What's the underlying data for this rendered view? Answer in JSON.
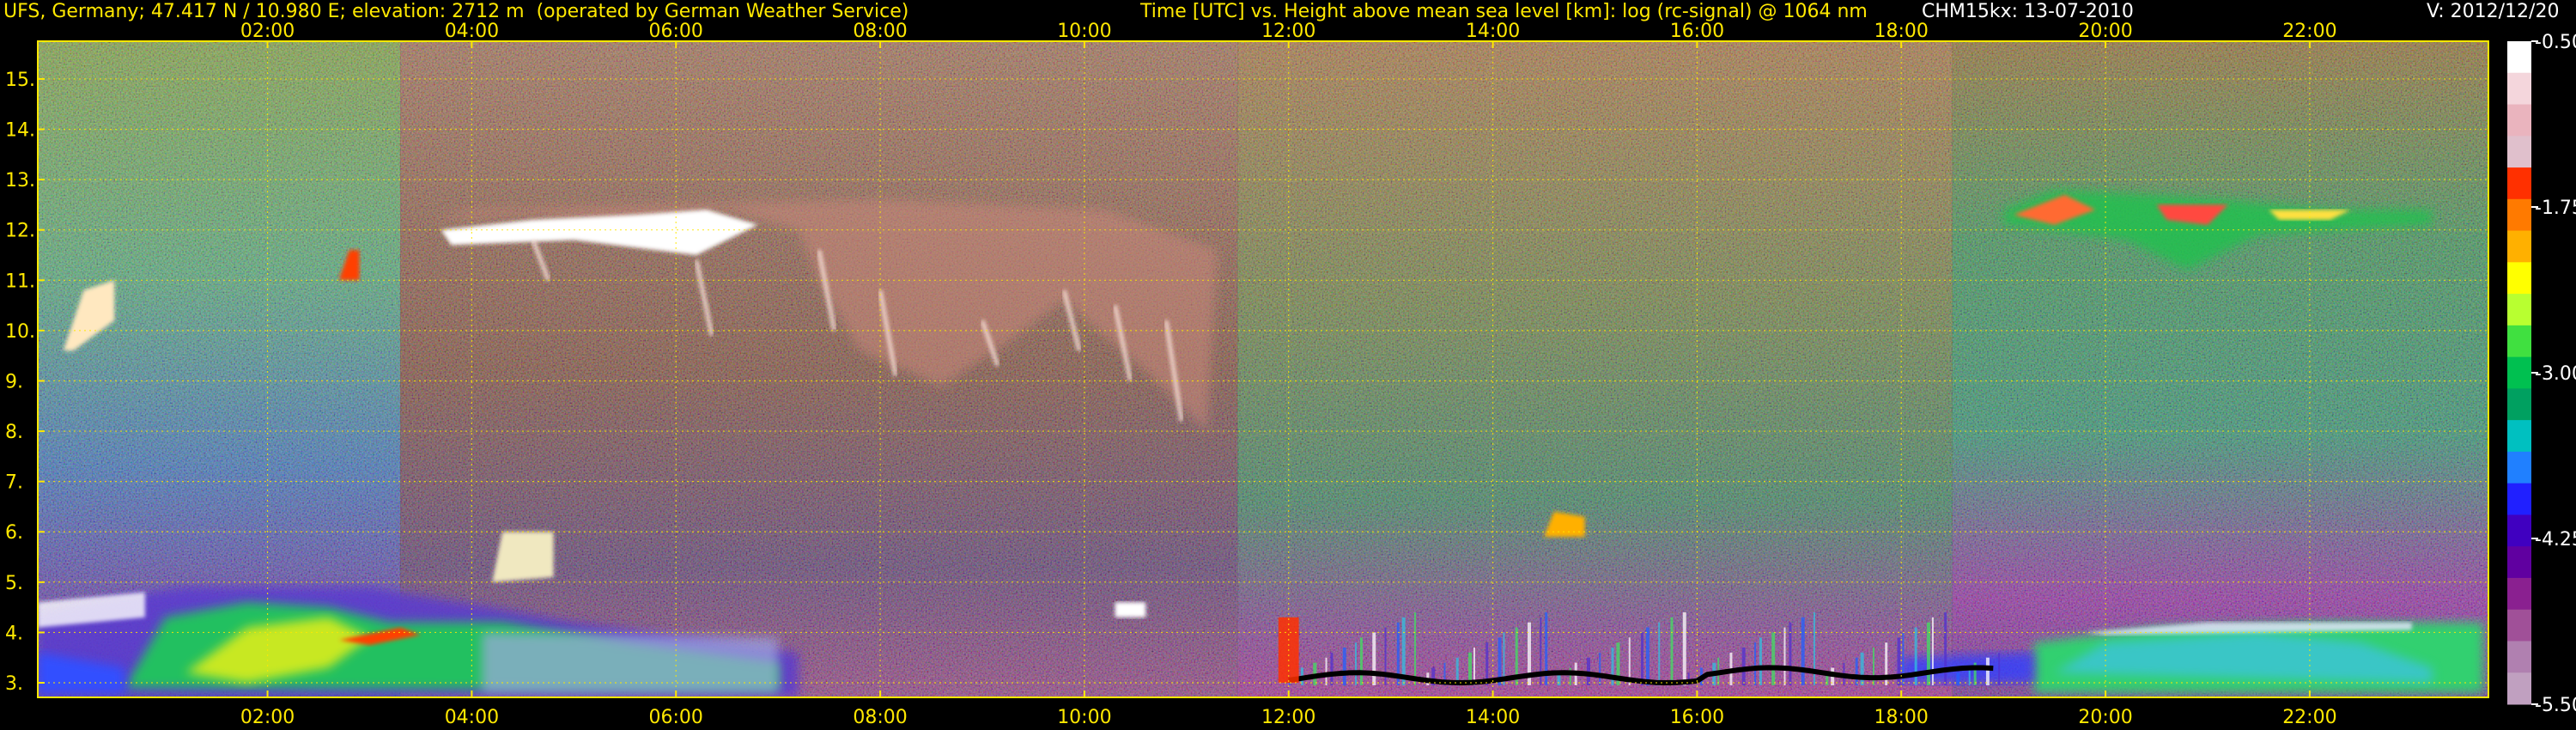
{
  "header": {
    "station": "UFS, Germany; 47.417 N / 10.980 E; elevation: 2712 m  (operated by German Weather Service)",
    "plot_title": "Time [UTC] vs. Height above mean sea level [km]: log (rc-signal) @ 1064 nm",
    "instrument_date": "CHM15kx: 13-07-2010",
    "version": "V: 2012/12/20"
  },
  "chart_data": {
    "type": "heatmap",
    "title": "Time [UTC] vs. Height above mean sea level [km]: log (rc-signal) @ 1064 nm",
    "xlabel": "",
    "ylabel": "",
    "x_unit": "hours UTC",
    "y_unit": "km",
    "xlim": [
      -0.25,
      23.75
    ],
    "ylim": [
      2.71,
      15.75
    ],
    "x_ticks": [
      {
        "value": 2,
        "label": "02:00"
      },
      {
        "value": 4,
        "label": "04:00"
      },
      {
        "value": 6,
        "label": "06:00"
      },
      {
        "value": 8,
        "label": "08:00"
      },
      {
        "value": 10,
        "label": "10:00"
      },
      {
        "value": 12,
        "label": "12:00"
      },
      {
        "value": 14,
        "label": "14:00"
      },
      {
        "value": 16,
        "label": "16:00"
      },
      {
        "value": 18,
        "label": "18:00"
      },
      {
        "value": 20,
        "label": "20:00"
      },
      {
        "value": 22,
        "label": "22:00"
      }
    ],
    "y_ticks": [
      {
        "value": 3,
        "label": "3."
      },
      {
        "value": 4,
        "label": "4."
      },
      {
        "value": 5,
        "label": "5."
      },
      {
        "value": 6,
        "label": "6."
      },
      {
        "value": 7,
        "label": "7."
      },
      {
        "value": 8,
        "label": "8."
      },
      {
        "value": 9,
        "label": "9."
      },
      {
        "value": 10,
        "label": "10."
      },
      {
        "value": 11,
        "label": "11."
      },
      {
        "value": 12,
        "label": "12."
      },
      {
        "value": 13,
        "label": "13."
      },
      {
        "value": 14,
        "label": "14."
      },
      {
        "value": 15,
        "label": "15."
      }
    ],
    "grid": true,
    "colorbar": {
      "range": [
        -5.5,
        -0.5
      ],
      "ticks": [
        {
          "value": -0.5,
          "label": "-0.50"
        },
        {
          "value": -1.75,
          "label": "-1.75"
        },
        {
          "value": -3.0,
          "label": "-3.00"
        },
        {
          "value": -4.25,
          "label": "-4.25"
        },
        {
          "value": -5.5,
          "label": "-5.50"
        }
      ],
      "colors_top_to_bottom": [
        "#ffffff",
        "#f4d6dc",
        "#eab4be",
        "#e0c0cc",
        "#ff3000",
        "#ff7a00",
        "#ffb000",
        "#ffff00",
        "#b8ff30",
        "#40e040",
        "#00c050",
        "#00a060",
        "#00c0c0",
        "#2080ff",
        "#2020ff",
        "#4000c0",
        "#6000a0",
        "#8a2090",
        "#a05098",
        "#b080b0",
        "#c0a0c0"
      ]
    },
    "features": [
      {
        "name": "cirrus cloud band",
        "x_range": [
          3.6,
          11.3
        ],
        "y_range": [
          7.8,
          12.4
        ]
      },
      {
        "name": "high cloud",
        "x_range": [
          19.0,
          23.2
        ],
        "y_range": [
          11.0,
          12.8
        ]
      },
      {
        "name": "mid-level cloud",
        "x_range": [
          14.5,
          14.9
        ],
        "y_range": [
          5.8,
          6.4
        ]
      },
      {
        "name": "boundary layer aerosol",
        "x_range": [
          0.0,
          7.2
        ],
        "y_range": [
          2.8,
          5.0
        ]
      },
      {
        "name": "boundary layer aerosol",
        "x_range": [
          19.3,
          23.7
        ],
        "y_range": [
          2.8,
          4.2
        ]
      },
      {
        "name": "low cloud",
        "x_range": [
          12.0,
          19.0
        ],
        "y_range": [
          2.8,
          4.8
        ]
      }
    ]
  }
}
